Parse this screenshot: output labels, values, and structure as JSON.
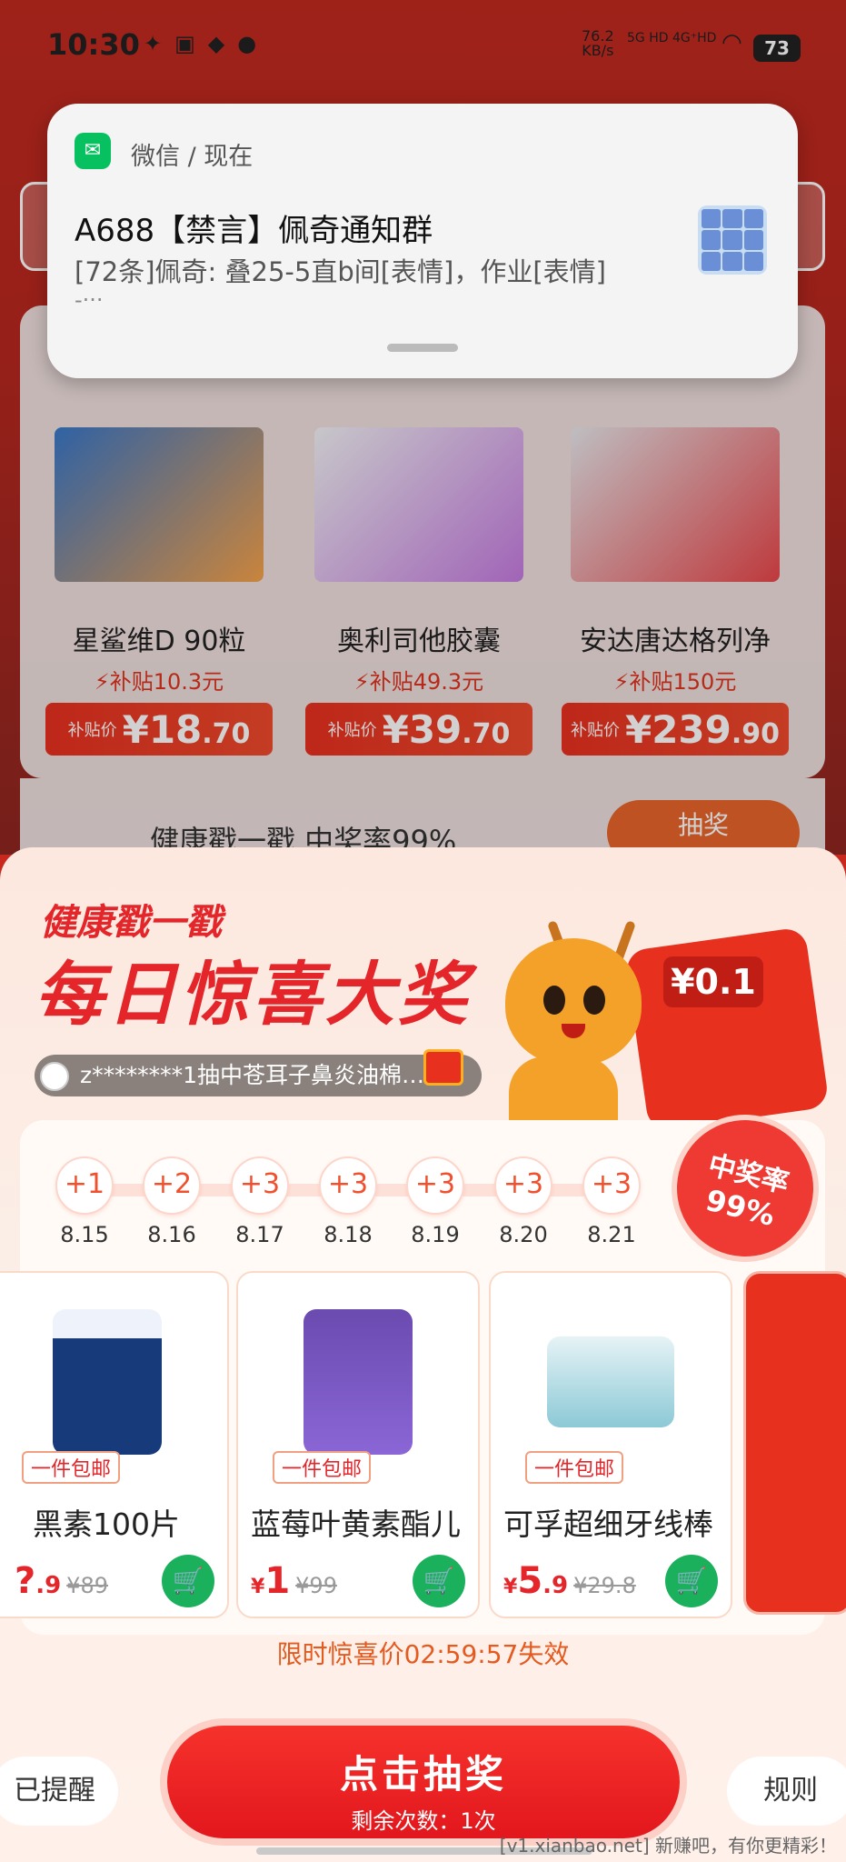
{
  "status_bar": {
    "time": "10:30",
    "net_speed": "76.2",
    "net_unit": "KB/s",
    "signal1": "5G HD",
    "signal2": "4G⁺HD",
    "battery": "73"
  },
  "notification": {
    "app": "微信 / 现在",
    "title": "A688【禁言】佩奇通知群",
    "body": "[72条]佩奇: 叠25-5直b间[表情]，作业[表情]",
    "body_more": "-···"
  },
  "subsidy": {
    "products": [
      {
        "name": "星鲨维D 90粒",
        "subsidy": "补贴10.3元",
        "price_label": "补贴价",
        "currency": "¥",
        "price_int": "18",
        "price_dec": ".70"
      },
      {
        "name": "奥利司他胶囊",
        "subsidy": "补贴49.3元",
        "price_label": "补贴价",
        "currency": "¥",
        "price_int": "39",
        "price_dec": ".70"
      },
      {
        "name": "安达唐达格列净",
        "subsidy": "补贴150元",
        "price_label": "补贴价",
        "currency": "¥",
        "price_int": "239",
        "price_dec": ".90"
      }
    ],
    "lottery_text": "健康戳一戳 中奖率99%",
    "lottery_btn": "抽奖"
  },
  "sheet": {
    "kicker": "健康戳一戳",
    "title": "每日惊喜大奖",
    "redpack_value": "¥0.1",
    "ticker": "z********1抽中苍耳子鼻炎油棉…",
    "badge_line1": "中奖率",
    "badge_line2": "99%",
    "days": [
      {
        "bonus": "+1",
        "date": "8.15"
      },
      {
        "bonus": "+2",
        "date": "8.16"
      },
      {
        "bonus": "+3",
        "date": "8.17"
      },
      {
        "bonus": "+3",
        "date": "8.18"
      },
      {
        "bonus": "+3",
        "date": "8.19"
      },
      {
        "bonus": "+3",
        "date": "8.20"
      },
      {
        "bonus": "+3",
        "date": "8.21"
      }
    ],
    "prizes": [
      {
        "tag": "一件包邮",
        "name": "黑素100片",
        "currency": "",
        "price": "?",
        "dec": ".9",
        "old": "¥89"
      },
      {
        "tag": "一件包邮",
        "name": "蓝莓叶黄素酯儿",
        "currency": "¥",
        "price": "1",
        "dec": "",
        "old": "¥99"
      },
      {
        "tag": "一件包邮",
        "name": "可孚超细牙线棒",
        "currency": "¥",
        "price": "5",
        "dec": ".9",
        "old": "¥29.8"
      }
    ],
    "countdown": "限时惊喜价02:59:57失效",
    "remind_btn": "已提醒",
    "draw_btn": "点击抽奖",
    "draw_remaining": "剩余次数：1次",
    "rules_btn": "规则"
  },
  "watermark": "[v1.xianbao.net] 新赚吧，有你更精彩！",
  "colors": {
    "accent_red": "#e4262b",
    "green": "#1bb05b",
    "orange": "#f4a12a"
  }
}
